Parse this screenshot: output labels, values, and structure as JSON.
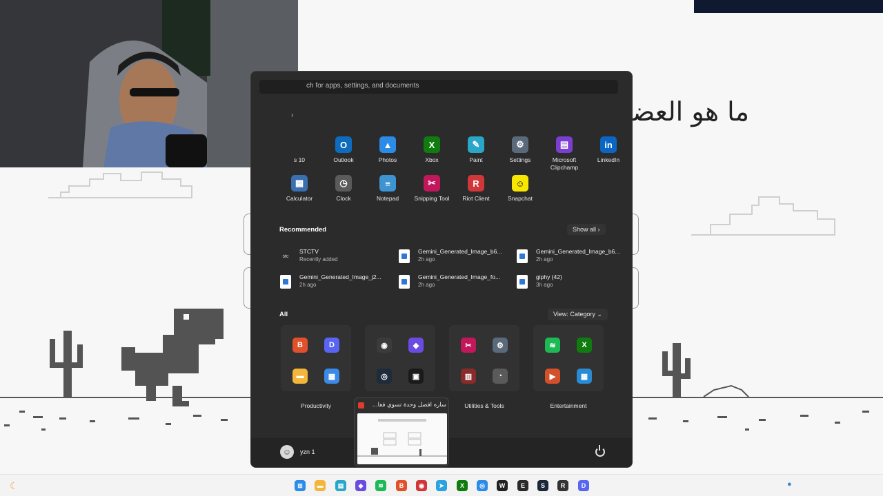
{
  "quiz": {
    "title": "ما هو العضو"
  },
  "start_menu": {
    "search_placeholder": "ch for apps, settings, and documents",
    "pinned_partial_label": "s 10",
    "pinned": [
      {
        "label": "Outlook",
        "icon": "outlook-icon",
        "color": "#0f6cbd",
        "glyph": "O"
      },
      {
        "label": "Photos",
        "icon": "photos-icon",
        "color": "#2b8be6",
        "glyph": "▲"
      },
      {
        "label": "Xbox",
        "icon": "xbox-icon",
        "color": "#107c10",
        "glyph": "X"
      },
      {
        "label": "Paint",
        "icon": "paint-icon",
        "color": "#2aa6c9",
        "glyph": "✎"
      },
      {
        "label": "Settings",
        "icon": "settings-icon",
        "color": "#5b6a7a",
        "glyph": "⚙"
      },
      {
        "label": "Microsoft Clipchamp",
        "icon": "clipchamp-icon",
        "color": "#7b3fd0",
        "glyph": "▤"
      },
      {
        "label": "LinkedIn",
        "icon": "linkedin-icon",
        "color": "#0a66c2",
        "glyph": "in"
      },
      {
        "label": "Calculator",
        "icon": "calculator-icon",
        "color": "#3a6fb0",
        "glyph": "▦"
      },
      {
        "label": "Clock",
        "icon": "clock-icon",
        "color": "#5b5b5b",
        "glyph": "◷"
      },
      {
        "label": "Notepad",
        "icon": "notepad-icon",
        "color": "#3d94d1",
        "glyph": "≡"
      },
      {
        "label": "Snipping Tool",
        "icon": "snipping-tool-icon",
        "color": "#c2185b",
        "glyph": "✂"
      },
      {
        "label": "Riot Client",
        "icon": "riot-client-icon",
        "color": "#d13639",
        "glyph": "R"
      },
      {
        "label": "Snapchat",
        "icon": "snapchat-icon",
        "color": "#f7e700",
        "glyph": "☺"
      }
    ],
    "recommended_title": "Recommended",
    "show_all": "Show all",
    "recommended": [
      {
        "name": "STCTV",
        "time": "Recently added",
        "icon": "stctv-icon"
      },
      {
        "name": "Gemini_Generated_Image_b6...",
        "time": "2h ago",
        "icon": "image-file-icon"
      },
      {
        "name": "Gemini_Generated_Image_b6...",
        "time": "2h ago",
        "icon": "image-file-icon"
      },
      {
        "name": "Gemini_Generated_Image_j2...",
        "time": "2h ago",
        "icon": "image-file-icon"
      },
      {
        "name": "Gemini_Generated_Image_fo...",
        "time": "2h ago",
        "icon": "image-file-icon"
      },
      {
        "name": "giphy (42)",
        "time": "3h ago",
        "icon": "image-file-icon"
      }
    ],
    "all_title": "All",
    "view_label": "View: Category",
    "folders": [
      {
        "label": "Productivity",
        "icons": [
          {
            "name": "brave-icon",
            "color": "#e0512b",
            "glyph": "B"
          },
          {
            "name": "discord-icon",
            "color": "#5865f2",
            "glyph": "D"
          },
          {
            "name": "file-explorer-icon",
            "color": "#f4b63a",
            "glyph": "▬"
          },
          {
            "name": "google-apps-icon",
            "color": "#3c8ae8",
            "glyph": "▦"
          }
        ]
      },
      {
        "label": "",
        "icons": [
          {
            "name": "obs-icon",
            "color": "#3b3b3b",
            "glyph": "◉"
          },
          {
            "name": "editor-icon",
            "color": "#6c4ce0",
            "glyph": "◆"
          },
          {
            "name": "camera-app-icon",
            "color": "#1d2b3a",
            "glyph": "◎"
          },
          {
            "name": "nvidia-icon",
            "color": "#1a1a1a",
            "glyph": "▣"
          }
        ]
      },
      {
        "label": "Utilities & Tools",
        "icons": [
          {
            "name": "snipping-icon",
            "color": "#c2185b",
            "glyph": "✂"
          },
          {
            "name": "settings-gear-icon",
            "color": "#5b6a7a",
            "glyph": "⚙"
          },
          {
            "name": "winrar-icon",
            "color": "#8a2b2b",
            "glyph": "▥"
          },
          {
            "name": "control-panel-icon",
            "color": "#5a5a5a",
            "glyph": "◔"
          }
        ]
      },
      {
        "label": "Entertainment",
        "icons": [
          {
            "name": "spotify-icon",
            "color": "#1db954",
            "glyph": "≋"
          },
          {
            "name": "xbox-folder-icon",
            "color": "#107c10",
            "glyph": "X"
          },
          {
            "name": "media-player-icon",
            "color": "#d4502a",
            "glyph": "▶"
          },
          {
            "name": "game-bar-icon",
            "color": "#2a8bd4",
            "glyph": "▦"
          }
        ]
      }
    ],
    "user_name": "yzn 1"
  },
  "preview": {
    "title": "ساره افضل وحدة تسوي فعا..."
  },
  "taskbar": {
    "apps": [
      {
        "name": "start-icon",
        "color": "#2b8be6",
        "glyph": "⊞"
      },
      {
        "name": "file-explorer-taskbar-icon",
        "color": "#f4b63a",
        "glyph": "▬"
      },
      {
        "name": "store-icon",
        "color": "#2aa6c9",
        "glyph": "▤"
      },
      {
        "name": "editor-taskbar-icon",
        "color": "#6c4ce0",
        "glyph": "◆"
      },
      {
        "name": "spotify-taskbar-icon",
        "color": "#1db954",
        "glyph": "≋"
      },
      {
        "name": "brave-taskbar-icon",
        "color": "#e0512b",
        "glyph": "B"
      },
      {
        "name": "lunar-icon",
        "color": "#d13639",
        "glyph": "◉"
      },
      {
        "name": "telegram-icon",
        "color": "#2aa3e0",
        "glyph": "➤"
      },
      {
        "name": "xbox-taskbar-icon",
        "color": "#107c10",
        "glyph": "X"
      },
      {
        "name": "photos-taskbar-icon",
        "color": "#2b8be6",
        "glyph": "◎"
      },
      {
        "name": "wolf-app-icon",
        "color": "#222222",
        "glyph": "W"
      },
      {
        "name": "epic-games-icon",
        "color": "#2a2a2a",
        "glyph": "E"
      },
      {
        "name": "steam-icon",
        "color": "#1b2838",
        "glyph": "S"
      },
      {
        "name": "riot-taskbar-icon",
        "color": "#333333",
        "glyph": "R"
      },
      {
        "name": "discord-taskbar-icon",
        "color": "#5865f2",
        "glyph": "D"
      }
    ]
  }
}
